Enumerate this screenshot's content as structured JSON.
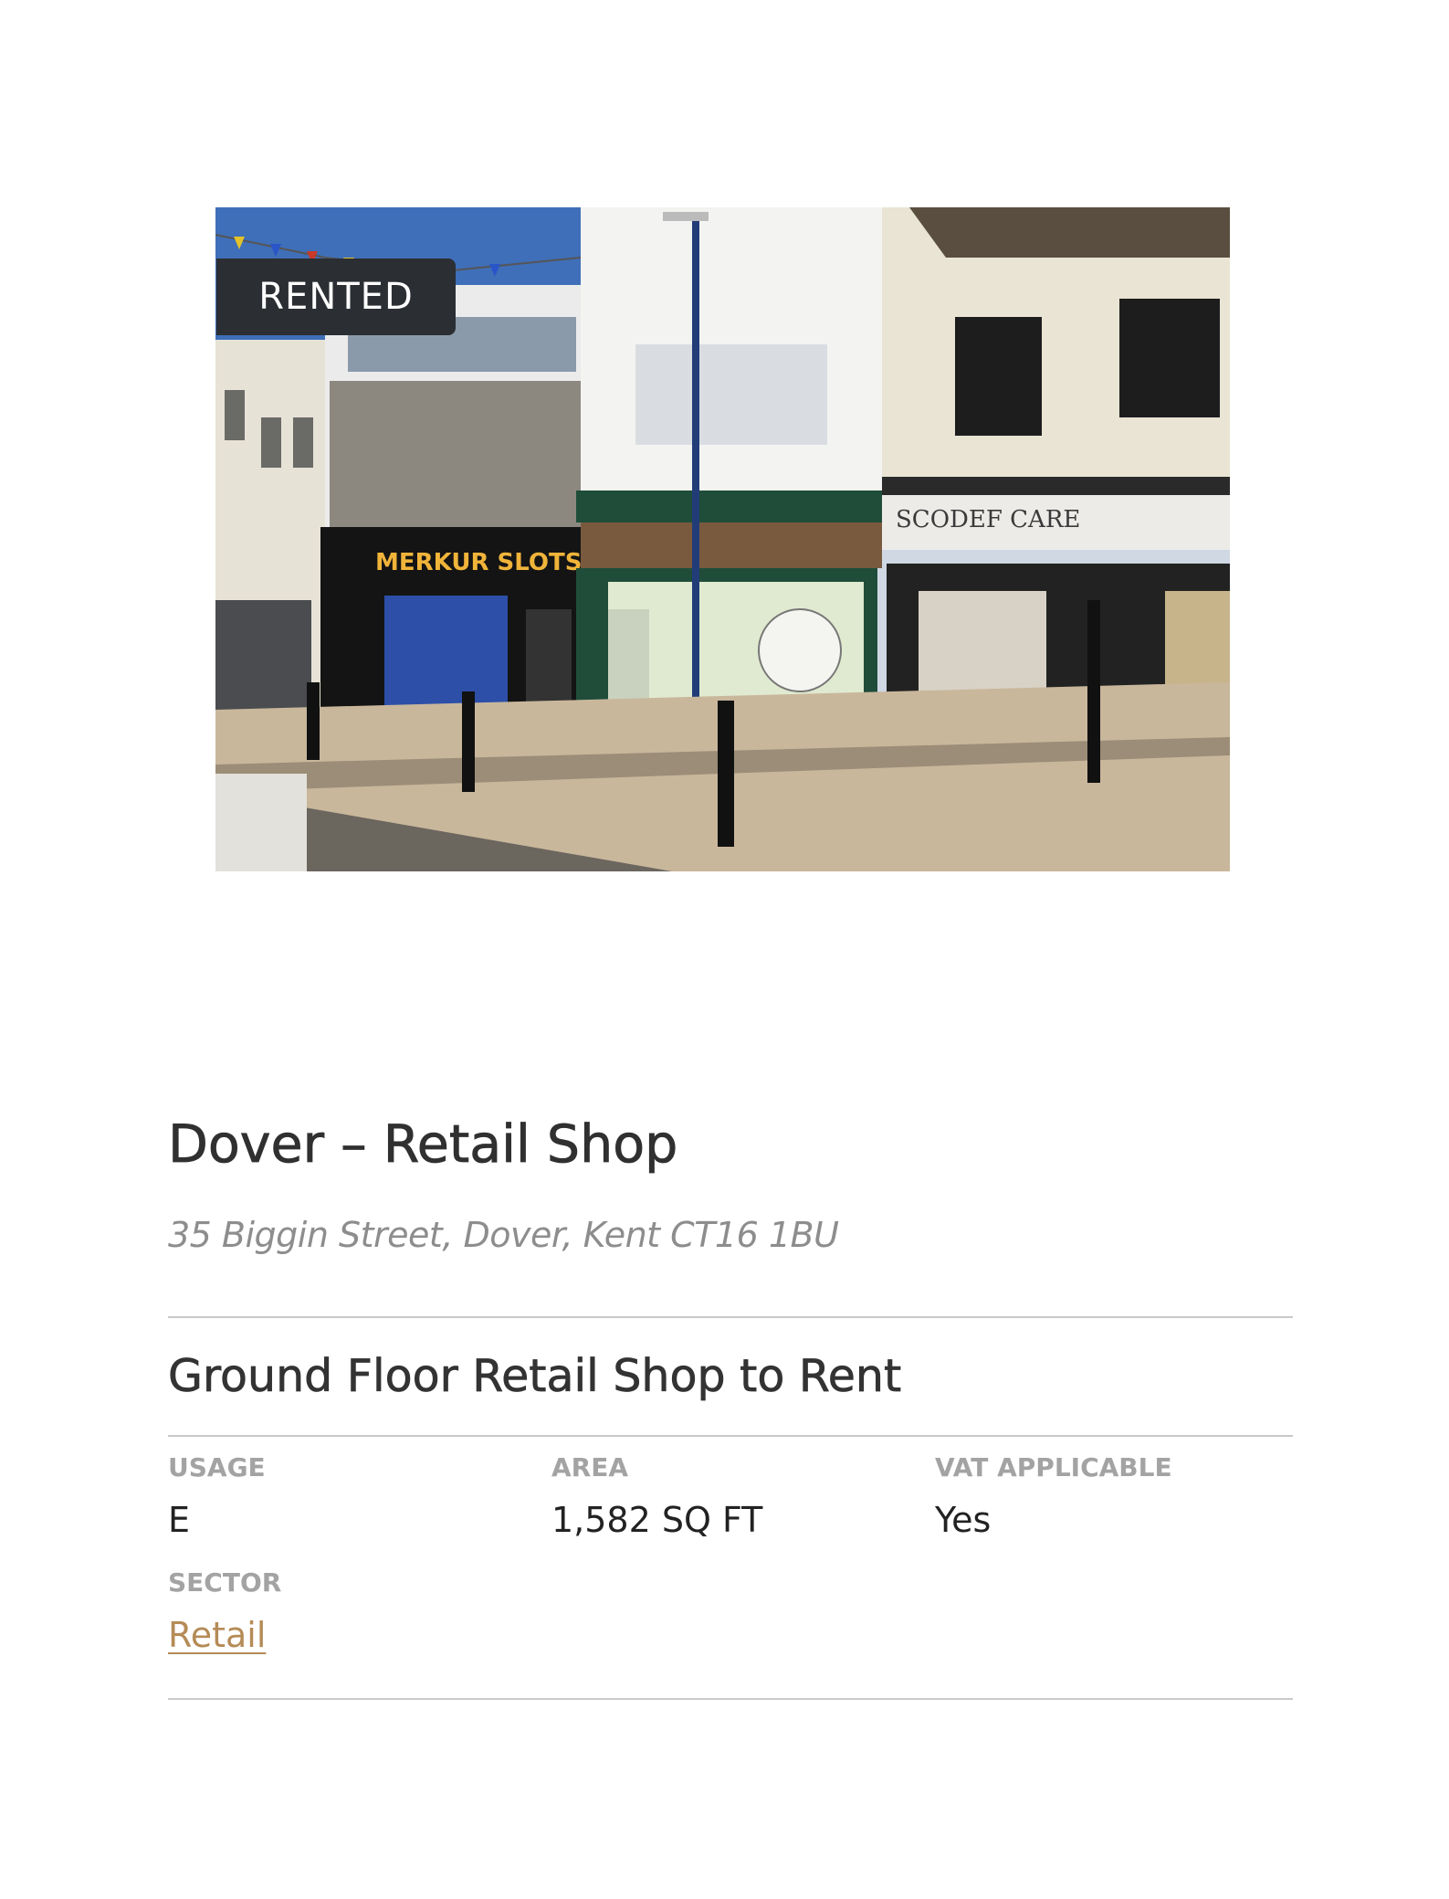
{
  "listing": {
    "status_badge": "RENTED",
    "photo_icon": "street-photo",
    "title": "Dover – Retail Shop",
    "address": "35 Biggin Street, Dover, Kent CT16 1BU",
    "subtitle": "Ground Floor Retail Shop to Rent",
    "specs": {
      "usage": {
        "label": "USAGE",
        "value": "E"
      },
      "area": {
        "label": "AREA",
        "value": "1,582 SQ FT"
      },
      "vat": {
        "label": "VAT APPLICABLE",
        "value": "Yes"
      },
      "sector": {
        "label": "SECTOR",
        "value": "Retail"
      }
    },
    "photo_signs": {
      "left_shop": "MERKUR SLOTS",
      "right_shop": "SCODEF CARE"
    }
  },
  "colors": {
    "badge_bg": "#2b2e33",
    "link": "#b58b57",
    "label_gray": "#a3a3a3",
    "address_gray": "#8d8d8d",
    "rule": "#c9c9c9"
  }
}
